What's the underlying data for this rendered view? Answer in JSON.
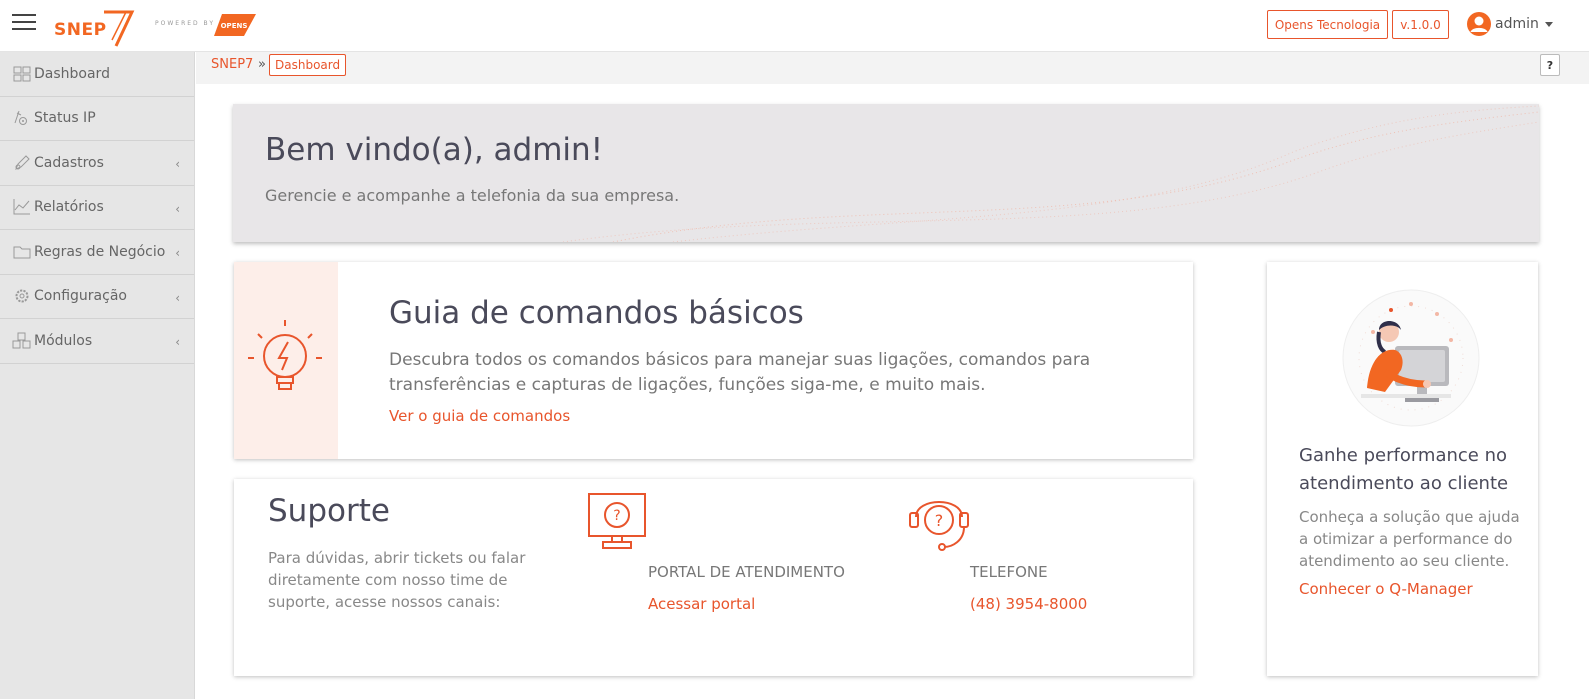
{
  "header": {
    "logo_text": "SNEP",
    "logo_number": "7",
    "powered_by": "POWERED BY",
    "powered_brand": "OPENS",
    "company_button": "Opens Tecnologia",
    "version_button": "v.1.0.0",
    "user_name": "admin"
  },
  "sidebar": {
    "items": [
      {
        "label": "Dashboard",
        "icon": "grid-icon",
        "has_submenu": false
      },
      {
        "label": "Status IP",
        "icon": "network-status-icon",
        "has_submenu": false
      },
      {
        "label": "Cadastros",
        "icon": "edit-icon",
        "has_submenu": true
      },
      {
        "label": "Relatórios",
        "icon": "line-chart-icon",
        "has_submenu": true
      },
      {
        "label": "Regras de Negócio",
        "icon": "folder-icon",
        "has_submenu": true
      },
      {
        "label": "Configuração",
        "icon": "gear-icon",
        "has_submenu": true
      },
      {
        "label": "Módulos",
        "icon": "cubes-icon",
        "has_submenu": true
      }
    ],
    "chevron": "‹"
  },
  "breadcrumb": {
    "root": "SNEP7",
    "separator": "»",
    "current": "Dashboard",
    "help": "?"
  },
  "welcome": {
    "title": "Bem vindo(a), admin!",
    "subtitle": "Gerencie e acompanhe a telefonia da sua empresa."
  },
  "guide": {
    "title": "Guia de comandos básicos",
    "description": "Descubra todos os comandos básicos para manejar suas ligações, comandos para transferências e capturas de ligações, funções siga-me, e muito mais.",
    "link": "Ver o guia de comandos",
    "icon": "lightbulb-icon"
  },
  "support": {
    "title": "Suporte",
    "description": "Para dúvidas, abrir tickets ou falar diretamente com nosso time de suporte, acesse nossos canais:",
    "portal": {
      "label": "PORTAL DE ATENDIMENTO",
      "link": "Acessar portal",
      "icon": "monitor-help-icon"
    },
    "phone": {
      "label": "TELEFONE",
      "link": "(48) 3954-8000",
      "icon": "headset-help-icon"
    }
  },
  "qmanager": {
    "title": "Ganhe performance no atendimento ao cliente",
    "description": "Conheça a solução que ajuda a otimizar a performance do atendimento ao seu cliente.",
    "link": "Conhecer o Q-Manager"
  },
  "colors": {
    "accent": "#e8552c",
    "sidebar_bg": "#e6e6e6",
    "welcome_bg": "#e8e6e8",
    "guide_icon_bg": "#fdeee9"
  }
}
